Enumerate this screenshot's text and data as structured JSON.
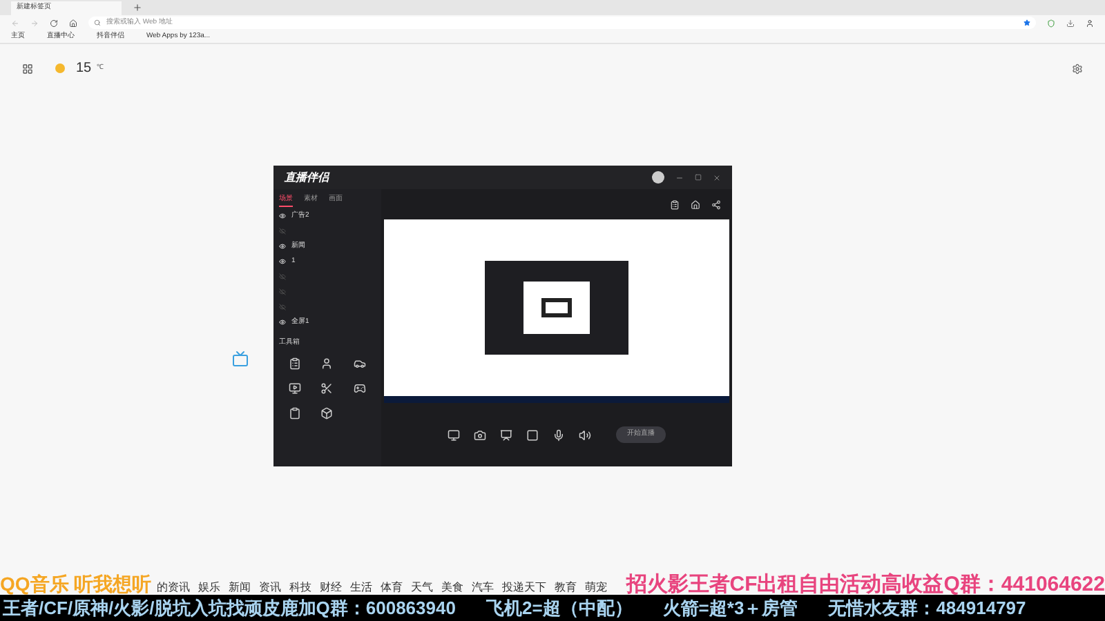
{
  "browser": {
    "tab_title": "新建标签页",
    "address_placeholder": "搜索或输入 Web 地址",
    "bookmarks": [
      "主页",
      "直播中心",
      "抖音伴侣",
      "Web Apps by 123a..."
    ]
  },
  "weather": {
    "temperature": "15",
    "unit": "℃"
  },
  "app": {
    "title": "直播伴侣",
    "left_tabs": [
      {
        "label": "场景",
        "selected": true
      },
      {
        "label": "素材",
        "selected": false
      },
      {
        "label": "画面",
        "selected": false
      }
    ],
    "sources": [
      {
        "name": "广告2",
        "visible": true
      },
      {
        "visible": false
      },
      {
        "name": "新闻",
        "visible": true
      },
      {
        "name": "1",
        "visible": true
      },
      {
        "visible": false
      },
      {
        "visible": false
      },
      {
        "visible": false
      },
      {
        "name": "全屏1",
        "visible": true
      }
    ],
    "toolbox_title": "工具箱",
    "live_button": "开始直播"
  },
  "overlays": {
    "music_logo": "QQ音乐 听我想听",
    "news_categories": [
      "的资讯",
      "娱乐",
      "新闻",
      "资讯",
      "科技",
      "财经",
      "生活",
      "体育",
      "天气",
      "美食",
      "汽车",
      "投递天下",
      "教育",
      "萌宠"
    ],
    "promo": "招火影王者CF出租自由活动高收益Q群：441064622",
    "ticker": [
      "王者/CF/原神/火影/脱坑入坑找顽皮鹿加Q群：600863940",
      "飞机2=超（中配）",
      "火箭=超*3＋房管",
      "无惜水友群：484914797"
    ]
  }
}
